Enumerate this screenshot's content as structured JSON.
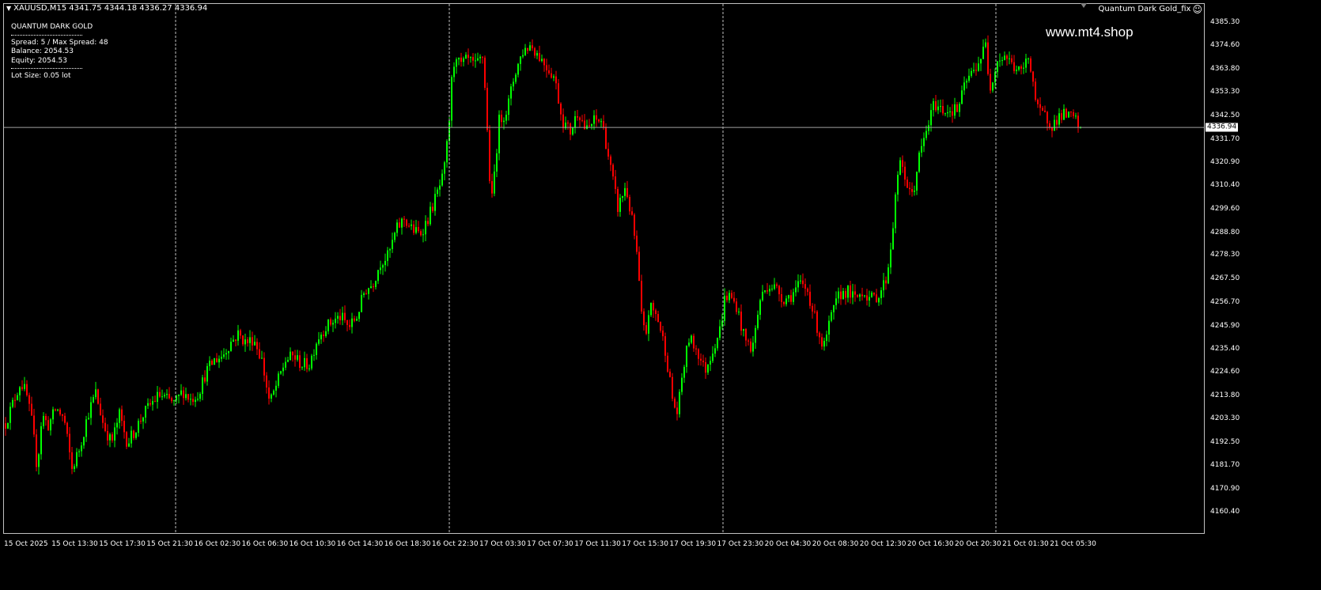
{
  "header": {
    "symbol_info": "XAUUSD,M15  4341.75 4344.18 4336.27 4336.94",
    "ea_name": "Quantum Dark Gold_fix",
    "smile_icon": "☺"
  },
  "watermark": "www.mt4.shop",
  "panel": {
    "title": "QUANTUM DARK GOLD",
    "spread": "Spread:  5 / Max Spread: 48",
    "balance": "Balance:  2054.53",
    "equity": "Equity:    2054.53",
    "lot": "Lot Size:  0.05 lot"
  },
  "price_axis": {
    "labels": [
      "4385.30",
      "4374.60",
      "4363.80",
      "4353.30",
      "4342.50",
      "4331.70",
      "4320.90",
      "4310.40",
      "4299.60",
      "4288.80",
      "4278.30",
      "4267.50",
      "4256.70",
      "4245.90",
      "4235.40",
      "4224.60",
      "4213.80",
      "4203.30",
      "4192.50",
      "4181.70",
      "4170.90",
      "4160.40"
    ],
    "bid": "4336.94"
  },
  "time_axis": {
    "labels": [
      "15 Oct 2025",
      "15 Oct 13:30",
      "15 Oct 17:30",
      "15 Oct 21:30",
      "16 Oct 02:30",
      "16 Oct 06:30",
      "16 Oct 10:30",
      "16 Oct 14:30",
      "16 Oct 18:30",
      "16 Oct 22:30",
      "17 Oct 03:30",
      "17 Oct 07:30",
      "17 Oct 11:30",
      "17 Oct 15:30",
      "17 Oct 19:30",
      "17 Oct 23:30",
      "20 Oct 04:30",
      "20 Oct 08:30",
      "20 Oct 12:30",
      "20 Oct 16:30",
      "20 Oct 20:30",
      "21 Oct 01:30",
      "21 Oct 05:30"
    ]
  },
  "colors": {
    "background": "#000000",
    "bull": "#00ff00",
    "bear": "#ff0000",
    "grid": "#c0c0c0",
    "bid_line": "#a0a0a0"
  },
  "chart_data": {
    "type": "candlestick",
    "symbol": "XAUUSD",
    "timeframe": "M15",
    "ylim": [
      4160.4,
      4385.3
    ],
    "last": {
      "open": 4341.75,
      "high": 4344.18,
      "low": 4336.27,
      "close": 4336.94
    },
    "path": [
      [
        0,
        4195
      ],
      [
        10,
        4205
      ],
      [
        20,
        4215
      ],
      [
        25,
        4220
      ],
      [
        32,
        4215
      ],
      [
        40,
        4200
      ],
      [
        46,
        4180
      ],
      [
        52,
        4205
      ],
      [
        60,
        4200
      ],
      [
        70,
        4208
      ],
      [
        80,
        4203
      ],
      [
        90,
        4180
      ],
      [
        100,
        4190
      ],
      [
        110,
        4205
      ],
      [
        120,
        4215
      ],
      [
        130,
        4200
      ],
      [
        140,
        4192
      ],
      [
        150,
        4205
      ],
      [
        160,
        4192
      ],
      [
        170,
        4198
      ],
      [
        180,
        4205
      ],
      [
        190,
        4210
      ],
      [
        200,
        4214
      ],
      [
        210,
        4212
      ],
      [
        220,
        4210
      ],
      [
        230,
        4216
      ],
      [
        240,
        4212
      ],
      [
        250,
        4215
      ],
      [
        260,
        4225
      ],
      [
        270,
        4230
      ],
      [
        280,
        4232
      ],
      [
        290,
        4238
      ],
      [
        300,
        4242
      ],
      [
        310,
        4238
      ],
      [
        320,
        4240
      ],
      [
        330,
        4230
      ],
      [
        340,
        4210
      ],
      [
        350,
        4220
      ],
      [
        360,
        4230
      ],
      [
        370,
        4232
      ],
      [
        380,
        4228
      ],
      [
        390,
        4228
      ],
      [
        400,
        4240
      ],
      [
        410,
        4245
      ],
      [
        420,
        4248
      ],
      [
        430,
        4250
      ],
      [
        440,
        4245
      ],
      [
        450,
        4250
      ],
      [
        460,
        4262
      ],
      [
        470,
        4265
      ],
      [
        480,
        4275
      ],
      [
        490,
        4278
      ],
      [
        500,
        4290
      ],
      [
        510,
        4295
      ],
      [
        520,
        4290
      ],
      [
        530,
        4288
      ],
      [
        540,
        4295
      ],
      [
        550,
        4305
      ],
      [
        560,
        4315
      ],
      [
        566,
        4335
      ],
      [
        570,
        4358
      ],
      [
        575,
        4372
      ],
      [
        580,
        4365
      ],
      [
        590,
        4368
      ],
      [
        600,
        4365
      ],
      [
        610,
        4370
      ],
      [
        615,
        4335
      ],
      [
        620,
        4300
      ],
      [
        625,
        4320
      ],
      [
        630,
        4340
      ],
      [
        640,
        4345
      ],
      [
        650,
        4362
      ],
      [
        660,
        4372
      ],
      [
        670,
        4375
      ],
      [
        680,
        4370
      ],
      [
        690,
        4365
      ],
      [
        700,
        4360
      ],
      [
        710,
        4340
      ],
      [
        720,
        4335
      ],
      [
        730,
        4345
      ],
      [
        740,
        4335
      ],
      [
        750,
        4340
      ],
      [
        760,
        4340
      ],
      [
        770,
        4320
      ],
      [
        780,
        4300
      ],
      [
        790,
        4310
      ],
      [
        800,
        4290
      ],
      [
        805,
        4275
      ],
      [
        810,
        4250
      ],
      [
        815,
        4240
      ],
      [
        820,
        4255
      ],
      [
        830,
        4250
      ],
      [
        840,
        4235
      ],
      [
        850,
        4210
      ],
      [
        856,
        4205
      ],
      [
        860,
        4220
      ],
      [
        870,
        4240
      ],
      [
        880,
        4235
      ],
      [
        890,
        4225
      ],
      [
        900,
        4235
      ],
      [
        910,
        4245
      ],
      [
        915,
        4258
      ],
      [
        920,
        4260
      ],
      [
        930,
        4255
      ],
      [
        940,
        4240
      ],
      [
        950,
        4235
      ],
      [
        960,
        4258
      ],
      [
        970,
        4265
      ],
      [
        980,
        4263
      ],
      [
        990,
        4258
      ],
      [
        1000,
        4260
      ],
      [
        1010,
        4265
      ],
      [
        1020,
        4262
      ],
      [
        1030,
        4248
      ],
      [
        1040,
        4235
      ],
      [
        1050,
        4250
      ],
      [
        1060,
        4260
      ],
      [
        1070,
        4262
      ],
      [
        1080,
        4258
      ],
      [
        1090,
        4262
      ],
      [
        1100,
        4258
      ],
      [
        1110,
        4260
      ],
      [
        1120,
        4268
      ],
      [
        1125,
        4282
      ],
      [
        1130,
        4300
      ],
      [
        1135,
        4320
      ],
      [
        1140,
        4318
      ],
      [
        1150,
        4305
      ],
      [
        1155,
        4310
      ],
      [
        1160,
        4322
      ],
      [
        1170,
        4335
      ],
      [
        1180,
        4348
      ],
      [
        1190,
        4345
      ],
      [
        1200,
        4345
      ],
      [
        1210,
        4345
      ],
      [
        1220,
        4358
      ],
      [
        1230,
        4363
      ],
      [
        1240,
        4370
      ],
      [
        1245,
        4375
      ],
      [
        1250,
        4355
      ],
      [
        1260,
        4368
      ],
      [
        1270,
        4370
      ],
      [
        1280,
        4365
      ],
      [
        1290,
        4362
      ],
      [
        1300,
        4370
      ],
      [
        1305,
        4358
      ],
      [
        1310,
        4345
      ],
      [
        1320,
        4342
      ],
      [
        1330,
        4338
      ],
      [
        1340,
        4343
      ],
      [
        1350,
        4342
      ],
      [
        1360,
        4340
      ],
      [
        1365,
        4337
      ]
    ]
  }
}
